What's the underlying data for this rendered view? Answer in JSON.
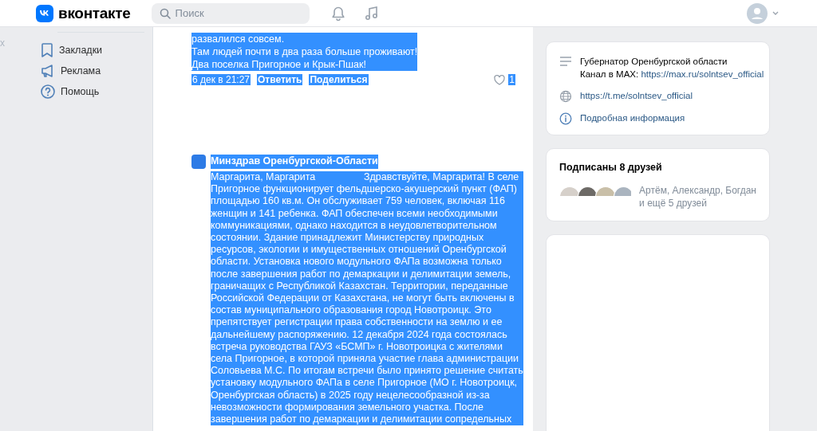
{
  "header": {
    "logo_text": "вконтакте",
    "search": {
      "placeholder": "Поиск"
    }
  },
  "sidebar": {
    "cut_text": "х",
    "items": [
      {
        "label": "Закладки"
      },
      {
        "label": "Реклама"
      },
      {
        "label": "Помощь"
      }
    ]
  },
  "comments": [
    {
      "kind": "reply",
      "text": "развалился совсем.\nТам людей почти в два раза больше проживают!\nДва поселка Пригорное и Крык-Пшак!",
      "date": "6 дек в 21:27",
      "actions": [
        "Ответить",
        "Поделиться"
      ],
      "likes": "1",
      "highlighted": true
    },
    {
      "kind": "post",
      "author": "Минздрав Оренбургской-Области",
      "reply_to": "Маргарита, Маргарита",
      "text": "Здравствуйте, Маргарита! В селе\nПригорное функционирует фельдшерско-акушерский пункт (ФАП)\nплощадью 160 кв.м. Он обслуживает 759 человек, включая 116\nженщин и 141 ребенка. ФАП обеспечен всеми необходимыми\nкоммуникациями, однако находится в неудовлетворительном\nсостоянии. Здание принадлежит Министерству природных\nресурсов, экологии и имущественных отношений Оренбургской\nобласти. Установка нового модульного ФАПа возможна только\nпосле завершения работ по демаркации и делимитации земель,\nграничащих с Республикой Казахстан. Территории, переданные\nРоссийской Федерации от Казахстана, не могут быть включены в\nсостав муниципального образования город Новотроицк. Это\nпрепятствует регистрации права собственности на землю и ее\nдальнейшему распоряжению. 12 декабря 2024 года состоялась\nвстреча руководства ГАУЗ «БСМП» г. Новотроицка с жителями\nсела Пригорное, в которой приняла участие глава администрации\nСоловьева М.С. По итогам встречи было принято решение считать\nустановку модульного ФАПа в селе Пригорное (МО г. Новотроицк,\nОренбургская область) в 2025 году нецелесообразной из-за\nневозможности формирования земельного участка. После\nзавершения работ по демаркации и делимитации сопредельных",
      "highlighted": true
    }
  ],
  "info_card": {
    "rows": [
      {
        "kind": "description",
        "text": "Губернатор Оренбургской области",
        "link_label": "Канал в MAX:",
        "link": "https://max.ru/solntsev_official"
      },
      {
        "kind": "site",
        "link": "https://t.me/solntsev_official"
      },
      {
        "kind": "more",
        "text": "Подробная информация"
      }
    ]
  },
  "friends_card": {
    "title": "Подписаны 8 друзей",
    "names": "Артём, Александр, Богдан",
    "more": "и ещё 5 друзей"
  }
}
